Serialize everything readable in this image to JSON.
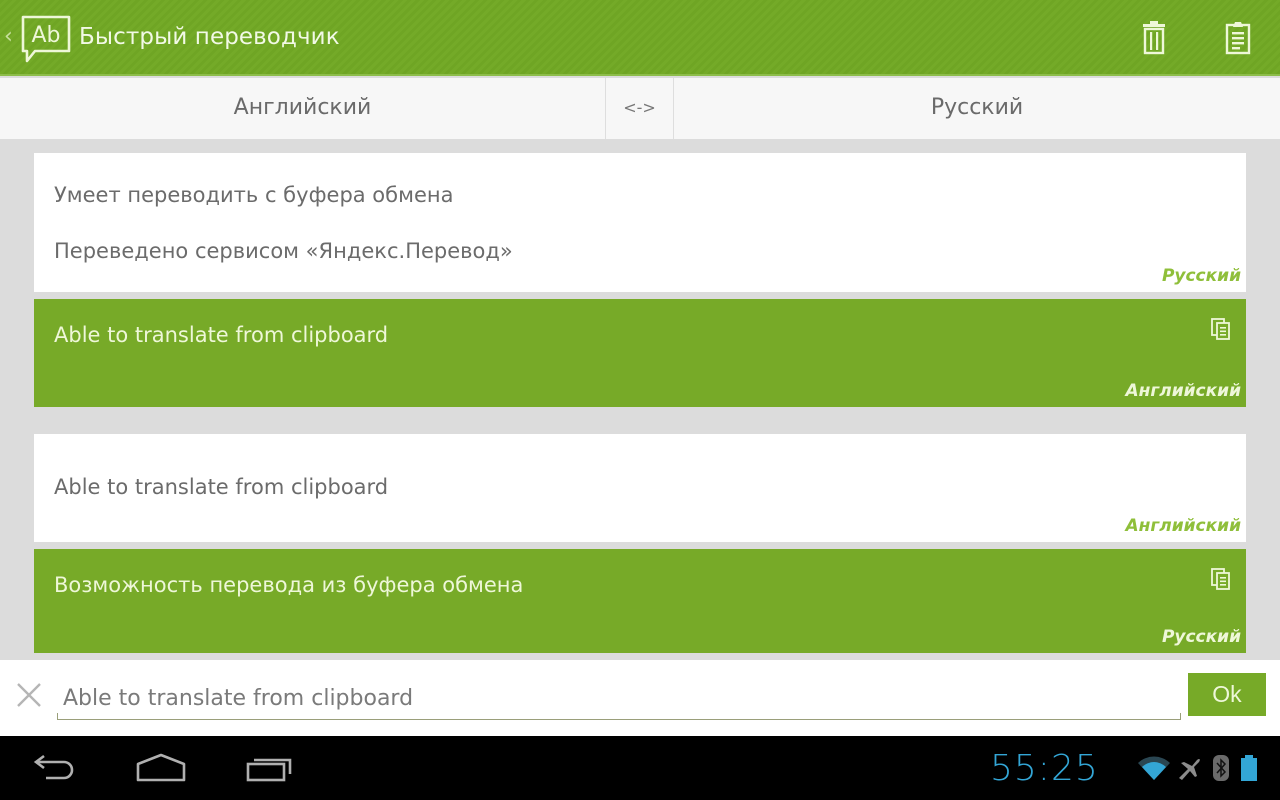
{
  "app": {
    "title": "Быстрый переводчик",
    "logo_text": "Ab",
    "actions": [
      {
        "name": "trash-icon",
        "label": "Clear history"
      },
      {
        "name": "clipboard-icon",
        "label": "Paste from clipboard"
      }
    ]
  },
  "languages": {
    "source": "Английский",
    "swap_label": "<->",
    "target": "Русский"
  },
  "history": [
    {
      "source_text": "Умеет переводить с буфера обмена",
      "source_note": "Переведено сервисом «Яндекс.Перевод»",
      "source_lang": "Русский",
      "result_text": "Able to translate from clipboard",
      "result_lang": "Английский"
    },
    {
      "source_text": "Able to translate from clipboard",
      "source_lang": "Английский",
      "result_text": "Возможность перевода из буфера обмена",
      "result_lang": "Русский"
    }
  ],
  "input": {
    "value": "Able to translate from clipboard",
    "ok_label": "Ok"
  },
  "status": {
    "time": "55:25"
  },
  "colors": {
    "accent": "#77aa28",
    "appbar": "#6fa524",
    "label_green": "#8fbf3a",
    "clock": "#33a6d6"
  }
}
